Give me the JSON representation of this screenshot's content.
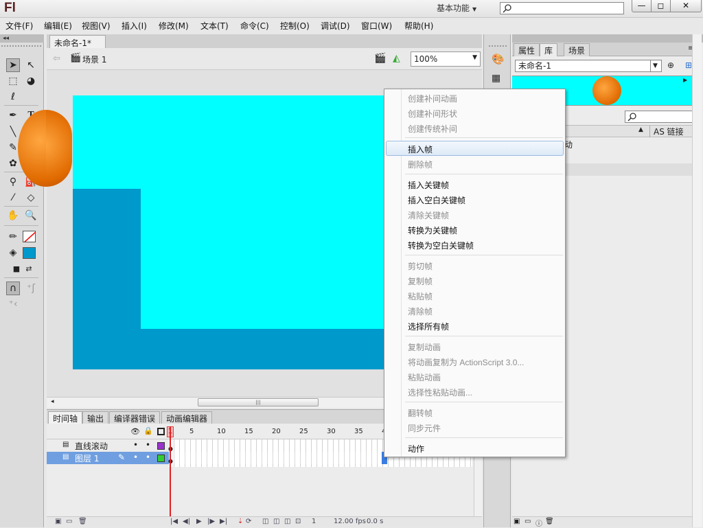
{
  "app": {
    "logo": "Fl",
    "workspace": "基本功能"
  },
  "window_buttons": {
    "minimize": "—",
    "maximize": "◻",
    "close": "✕"
  },
  "menu": [
    "文件(F)",
    "编辑(E)",
    "视图(V)",
    "插入(I)",
    "修改(M)",
    "文本(T)",
    "命令(C)",
    "控制(O)",
    "调试(D)",
    "窗口(W)",
    "帮助(H)"
  ],
  "document": {
    "tab_label": "未命名-1*",
    "tab_close": "×",
    "scene_label": "场景 1",
    "zoom": "100%"
  },
  "timeline": {
    "tabs": [
      "时间轴",
      "输出",
      "编译器错误",
      "动画编辑器"
    ],
    "frame_numbers": [
      "1",
      "5",
      "10",
      "15",
      "20",
      "25",
      "30",
      "35",
      "4"
    ],
    "layers": [
      {
        "name": "直线滚动",
        "color": "#9933cc",
        "selected": false
      },
      {
        "name": "图层 1",
        "color": "#33cc33",
        "selected": true
      }
    ],
    "status": {
      "current_frame": "1",
      "fps_value": "12.00",
      "fps_unit": "fps",
      "time": "0.0 s"
    }
  },
  "right_panel": {
    "tabs": [
      "属性",
      "库",
      "场景"
    ],
    "active_tab": "库",
    "library_select": "未命名-1",
    "column_header": "AS 链接",
    "partial_item_text": "动"
  },
  "context_menu": {
    "items": [
      {
        "label": "创建补间动画",
        "enabled": false
      },
      {
        "label": "创建补间形状",
        "enabled": false
      },
      {
        "label": "创建传统补间",
        "enabled": false
      },
      {
        "label": "插入帧",
        "enabled": true,
        "highlighted": true
      },
      {
        "label": "删除帧",
        "enabled": false
      },
      {
        "label": "插入关键帧",
        "enabled": true
      },
      {
        "label": "插入空白关键帧",
        "enabled": true
      },
      {
        "label": "清除关键帧",
        "enabled": false
      },
      {
        "label": "转换为关键帧",
        "enabled": true
      },
      {
        "label": "转换为空白关键帧",
        "enabled": true
      },
      {
        "label": "剪切帧",
        "enabled": false
      },
      {
        "label": "复制帧",
        "enabled": false
      },
      {
        "label": "粘贴帧",
        "enabled": false
      },
      {
        "label": "清除帧",
        "enabled": false
      },
      {
        "label": "选择所有帧",
        "enabled": true
      },
      {
        "label": "复制动画",
        "enabled": false
      },
      {
        "label": "将动画复制为 ActionScript 3.0...",
        "enabled": false
      },
      {
        "label": "粘贴动画",
        "enabled": false
      },
      {
        "label": "选择性粘贴动画...",
        "enabled": false
      },
      {
        "label": "翻转帧",
        "enabled": false
      },
      {
        "label": "同步元件",
        "enabled": false
      },
      {
        "label": "动作",
        "enabled": true
      }
    ]
  },
  "colors": {
    "stage_bg": "#00ffff",
    "shape_fill": "#0099cc",
    "fill_swatch": "#0099cc",
    "ball": "#e87a10",
    "playhead": "#e02020"
  }
}
